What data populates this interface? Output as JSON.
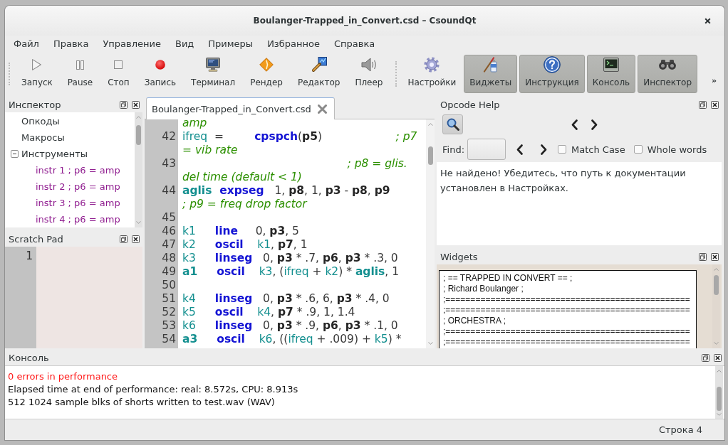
{
  "window": {
    "title": "Boulanger-Trapped_in_Convert.csd – CsoundQt"
  },
  "menu": [
    "Файл",
    "Правка",
    "Управление",
    "Вид",
    "Примеры",
    "Избранное",
    "Справка"
  ],
  "toolbar": {
    "groups": [
      [
        {
          "label": "Запуск",
          "checked": false
        },
        {
          "label": "Pause",
          "checked": false
        },
        {
          "label": "Стоп",
          "checked": false
        },
        {
          "label": "Запись",
          "checked": false
        },
        {
          "label": "Терминал",
          "checked": false
        },
        {
          "label": "Рендер",
          "checked": false
        },
        {
          "label": "Редактор",
          "checked": false
        },
        {
          "label": "Плеер",
          "checked": false
        }
      ],
      [
        {
          "label": "Настройки",
          "checked": false
        },
        {
          "label": "Виджеты",
          "checked": true
        },
        {
          "label": "Инструкция",
          "checked": true
        },
        {
          "label": "Консоль",
          "checked": true
        },
        {
          "label": "Инспектор",
          "checked": true
        }
      ]
    ],
    "overflow": "»"
  },
  "inspector": {
    "title": "Инспектор",
    "tree": [
      {
        "label": "Опкоды"
      },
      {
        "label": "Макросы"
      },
      {
        "label": "Инструменты",
        "expanded": true,
        "children": [
          {
            "label": "instr 1 ; p6 = amp"
          },
          {
            "label": "instr 2 ; p6 = amp"
          },
          {
            "label": "instr 3 ; p6 = amp"
          },
          {
            "label": "instr 4 ; p6 = amp"
          }
        ]
      }
    ]
  },
  "scratch_pad": {
    "title": "Scratch Pad",
    "line_numbers": [
      "1"
    ]
  },
  "editor": {
    "tabs": [
      {
        "label": "Boulanger-Trapped_in_Convert.csd",
        "selected": true
      }
    ],
    "rows": [
      {
        "tokens": [
          {
            "kind": "comment",
            "text": "amp"
          }
        ]
      },
      {
        "number": "42",
        "tokens": [
          {
            "kind": "variable",
            "text": "ifreq"
          },
          {
            "kind": "plain",
            "text": "  ="
          },
          {
            "kind": "opcode",
            "text": "        cpspch"
          },
          {
            "kind": "plain",
            "text": "("
          },
          {
            "kind": "pfield",
            "text": "p5"
          },
          {
            "kind": "plain",
            "text": ")"
          },
          {
            "kind": "comment",
            "text": "                     ; p7"
          }
        ]
      },
      {
        "tokens": [
          {
            "kind": "comment",
            "text": "= vib rate"
          }
        ]
      },
      {
        "number": "43",
        "tokens": [
          {
            "kind": "comment",
            "text": "                                               ; p8 = glis."
          }
        ]
      },
      {
        "tokens": [
          {
            "kind": "comment",
            "text": "del time (default < 1)"
          }
        ]
      },
      {
        "number": "44",
        "tokens": [
          {
            "kind": "audio_variable",
            "text": "aglis"
          },
          {
            "kind": "opcode",
            "text": "  expseg"
          },
          {
            "kind": "plain",
            "text": "   1, "
          },
          {
            "kind": "pfield",
            "text": "p8"
          },
          {
            "kind": "plain",
            "text": ", 1, "
          },
          {
            "kind": "pfield",
            "text": "p3"
          },
          {
            "kind": "plain",
            "text": " - "
          },
          {
            "kind": "pfield",
            "text": "p8"
          },
          {
            "kind": "plain",
            "text": ", "
          },
          {
            "kind": "pfield",
            "text": "p9"
          }
        ]
      },
      {
        "tokens": [
          {
            "kind": "comment",
            "text": "; p9 = freq drop factor"
          }
        ]
      },
      {
        "number": "45"
      },
      {
        "number": "46",
        "tokens": [
          {
            "kind": "variable",
            "text": "k1"
          },
          {
            "kind": "opcode",
            "text": "     line"
          },
          {
            "kind": "plain",
            "text": "     0, "
          },
          {
            "kind": "pfield",
            "text": "p3"
          },
          {
            "kind": "plain",
            "text": ", 5"
          }
        ]
      },
      {
        "number": "47",
        "tokens": [
          {
            "kind": "variable",
            "text": "k2"
          },
          {
            "kind": "opcode",
            "text": "     oscil"
          },
          {
            "kind": "variable",
            "text": "    k1"
          },
          {
            "kind": "plain",
            "text": ", "
          },
          {
            "kind": "pfield",
            "text": "p7"
          },
          {
            "kind": "plain",
            "text": ", 1"
          }
        ]
      },
      {
        "number": "48",
        "tokens": [
          {
            "kind": "variable",
            "text": "k3"
          },
          {
            "kind": "opcode",
            "text": "     linseg"
          },
          {
            "kind": "plain",
            "text": "   0, "
          },
          {
            "kind": "pfield",
            "text": "p3"
          },
          {
            "kind": "plain",
            "text": " * .7, "
          },
          {
            "kind": "pfield",
            "text": "p6"
          },
          {
            "kind": "plain",
            "text": ", "
          },
          {
            "kind": "pfield",
            "text": "p3"
          },
          {
            "kind": "plain",
            "text": " * .3, 0"
          }
        ]
      },
      {
        "number": "49",
        "tokens": [
          {
            "kind": "audio_variable",
            "text": "a1"
          },
          {
            "kind": "opcode",
            "text": "     oscil"
          },
          {
            "kind": "variable",
            "text": "    k3"
          },
          {
            "kind": "plain",
            "text": ", ("
          },
          {
            "kind": "variable",
            "text": "ifreq"
          },
          {
            "kind": "plain",
            "text": " + "
          },
          {
            "kind": "variable",
            "text": "k2"
          },
          {
            "kind": "plain",
            "text": ") * "
          },
          {
            "kind": "audio_variable",
            "text": "aglis"
          },
          {
            "kind": "plain",
            "text": ", 1"
          }
        ]
      },
      {
        "number": "50"
      },
      {
        "number": "51",
        "tokens": [
          {
            "kind": "variable",
            "text": "k4"
          },
          {
            "kind": "opcode",
            "text": "     linseg"
          },
          {
            "kind": "plain",
            "text": "   0, "
          },
          {
            "kind": "pfield",
            "text": "p3"
          },
          {
            "kind": "plain",
            "text": " * .6, 6, "
          },
          {
            "kind": "pfield",
            "text": "p3"
          },
          {
            "kind": "plain",
            "text": " * .4, 0"
          }
        ]
      },
      {
        "number": "52",
        "tokens": [
          {
            "kind": "variable",
            "text": "k5"
          },
          {
            "kind": "opcode",
            "text": "     oscil"
          },
          {
            "kind": "variable",
            "text": "    k4"
          },
          {
            "kind": "plain",
            "text": ", "
          },
          {
            "kind": "pfield",
            "text": "p7"
          },
          {
            "kind": "plain",
            "text": " * .9, 1, 1.4"
          }
        ]
      },
      {
        "number": "53",
        "tokens": [
          {
            "kind": "variable",
            "text": "k6"
          },
          {
            "kind": "opcode",
            "text": "     linseg"
          },
          {
            "kind": "plain",
            "text": "   0, "
          },
          {
            "kind": "pfield",
            "text": "p3"
          },
          {
            "kind": "plain",
            "text": " * .9, "
          },
          {
            "kind": "pfield",
            "text": "p6"
          },
          {
            "kind": "plain",
            "text": ", "
          },
          {
            "kind": "pfield",
            "text": "p3"
          },
          {
            "kind": "plain",
            "text": " * .1, 0"
          }
        ]
      },
      {
        "number": "54",
        "tokens": [
          {
            "kind": "audio_variable",
            "text": "a3"
          },
          {
            "kind": "opcode",
            "text": "     oscil"
          },
          {
            "kind": "variable",
            "text": "    k6"
          },
          {
            "kind": "plain",
            "text": ", (("
          },
          {
            "kind": "variable",
            "text": "ifreq"
          },
          {
            "kind": "plain",
            "text": " + .009) + "
          },
          {
            "kind": "variable",
            "text": "k5"
          },
          {
            "kind": "plain",
            "text": ") *"
          }
        ]
      }
    ]
  },
  "opcode_help": {
    "title": "Opcode Help",
    "find_label": "Find:",
    "options": [
      {
        "label": "Match Case",
        "checked": false
      },
      {
        "label": "Whole words",
        "checked": false
      }
    ],
    "message": "Не найдено! Убедитесь, что путь к документации установлен в Настройках."
  },
  "widgets": {
    "title": "Widgets",
    "lines": [
      "; == TRAPPED IN CONVERT == ;",
      "; Richard Boulanger ;",
      ";=================================================",
      ";=================================================",
      "; ORCHESTRA ;",
      ";=================================================",
      ";================================================="
    ]
  },
  "console": {
    "title": "Консоль",
    "lines": [
      {
        "kind": "error",
        "text": "0 errors in performance"
      },
      {
        "kind": "info",
        "text": "Elapsed time at end of performance: real: 8.572s, CPU: 8.913s"
      },
      {
        "kind": "info",
        "text": "512 1024 sample blks of shorts written to test.wav (WAV)"
      }
    ]
  },
  "status_bar": {
    "position": "Строка 4"
  }
}
